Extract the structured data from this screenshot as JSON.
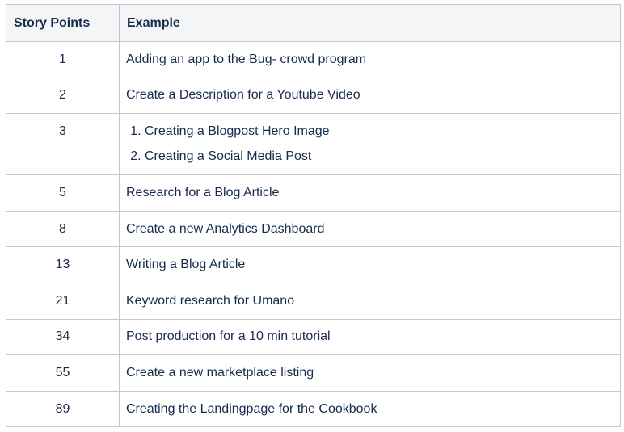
{
  "table": {
    "headers": [
      "Story Points",
      "Example"
    ],
    "rows": [
      {
        "points": "1",
        "example": "Adding an app to the Bug- crowd program"
      },
      {
        "points": "2",
        "example": "Create a Description for a Youtube Video"
      },
      {
        "points": "3",
        "list": [
          "Creating a Blogpost Hero Image",
          "Creating a Social Media Post"
        ]
      },
      {
        "points": "5",
        "example": "Research for a Blog Article"
      },
      {
        "points": "8",
        "example": "Create a new Analytics Dashboard"
      },
      {
        "points": "13",
        "example": "Writing a Blog Article"
      },
      {
        "points": "21",
        "example": "Keyword research for Umano"
      },
      {
        "points": "34",
        "example": "Post production for a 10 min tutorial"
      },
      {
        "points": "55",
        "example": "Create a new marketplace listing"
      },
      {
        "points": "89",
        "example": "Creating the Landingpage for the Cookbook"
      }
    ]
  }
}
